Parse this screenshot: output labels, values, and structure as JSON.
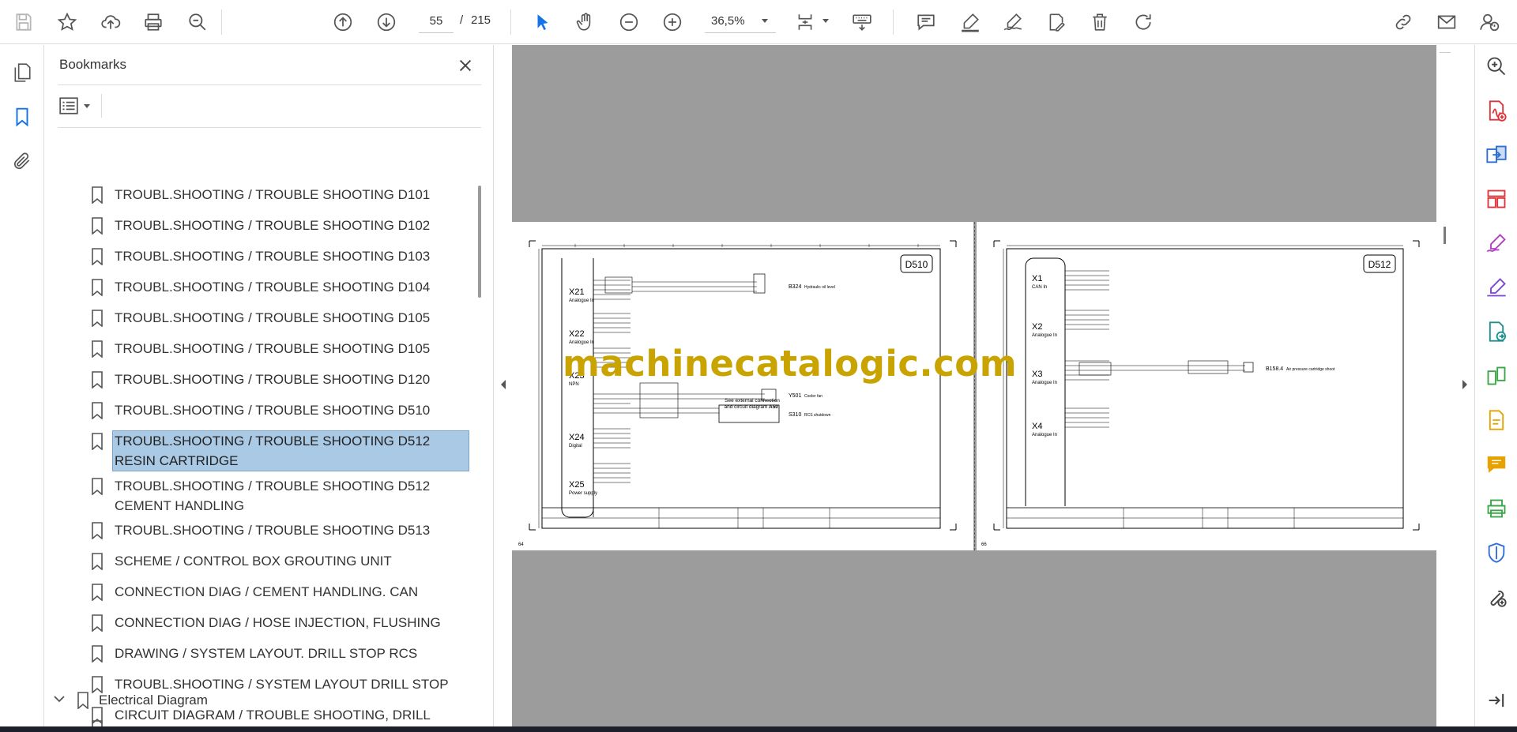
{
  "toolbar": {
    "tools": [
      {
        "name": "save-icon"
      },
      {
        "name": "star-icon"
      },
      {
        "name": "upload-cloud-icon"
      },
      {
        "name": "print-icon"
      },
      {
        "name": "search-zoom-icon"
      },
      {
        "name": "page-up-icon"
      },
      {
        "name": "page-down-icon"
      },
      {
        "name": "select-cursor-icon"
      },
      {
        "name": "hand-icon"
      },
      {
        "name": "zoom-out-icon"
      },
      {
        "name": "zoom-in-icon"
      },
      {
        "name": "page-fit-icon"
      },
      {
        "name": "keyboard-icon"
      },
      {
        "name": "comment-icon"
      },
      {
        "name": "highlight-icon"
      },
      {
        "name": "sign-icon"
      },
      {
        "name": "edit-pdf-icon"
      },
      {
        "name": "delete-icon"
      },
      {
        "name": "rotate-icon"
      },
      {
        "name": "link-icon"
      },
      {
        "name": "email-icon"
      },
      {
        "name": "account-icon"
      }
    ],
    "page_number": "55",
    "page_separator": "/",
    "page_total": "215",
    "zoom": "36,5%"
  },
  "bookmarks": {
    "title": "Bookmarks",
    "items": [
      {
        "label": "TROUBL.SHOOTING / TROUBLE SHOOTING D101"
      },
      {
        "label": "TROUBL.SHOOTING / TROUBLE SHOOTING D102"
      },
      {
        "label": "TROUBL.SHOOTING / TROUBLE SHOOTING D103"
      },
      {
        "label": "TROUBL.SHOOTING / TROUBLE SHOOTING D104"
      },
      {
        "label": "TROUBL.SHOOTING / TROUBLE SHOOTING D105"
      },
      {
        "label": "TROUBL.SHOOTING / TROUBLE SHOOTING D105"
      },
      {
        "label": "TROUBL.SHOOTING / TROUBLE SHOOTING D120"
      },
      {
        "label": "TROUBL.SHOOTING / TROUBLE SHOOTING D510"
      },
      {
        "label": "TROUBL.SHOOTING / TROUBLE SHOOTING D512 RESIN CARTRIDGE",
        "selected": true
      },
      {
        "label": "TROUBL.SHOOTING / TROUBLE SHOOTING D512 CEMENT HANDLING"
      },
      {
        "label": "TROUBL.SHOOTING / TROUBLE SHOOTING D513"
      },
      {
        "label": "SCHEME / CONTROL BOX GROUTING UNIT"
      },
      {
        "label": "CONNECTION DIAG / CEMENT HANDLING. CAN"
      },
      {
        "label": "CONNECTION DIAG / HOSE INJECTION, FLUSHING"
      },
      {
        "label": "DRAWING / SYSTEM LAYOUT. DRILL STOP RCS"
      },
      {
        "label": "TROUBL.SHOOTING / SYSTEM LAYOUT DRILL STOP"
      },
      {
        "label": "CIRCUIT DIAGRAM / TROUBLE SHOOTING, DRILL STOP"
      }
    ],
    "parent_item": {
      "label": "Electrical Diagram"
    }
  },
  "document": {
    "watermark": "machinecatalogic.com",
    "left_page": {
      "diagram_id": "D510",
      "page_no": "64",
      "connectors": [
        {
          "id": "X21",
          "desc": "Analogue In"
        },
        {
          "id": "X22",
          "desc": "Analogue In"
        },
        {
          "id": "X23",
          "desc": "NPN"
        },
        {
          "id": "X24",
          "desc": "Digital"
        },
        {
          "id": "X25",
          "desc": "Power supply"
        }
      ],
      "components": [
        {
          "id": "B324",
          "desc": "Hydraulic oil level"
        },
        {
          "id": "Y501",
          "desc": "Cooler fan"
        },
        {
          "id": "S310",
          "desc": "RCS shutdown"
        }
      ],
      "note_line1": "See external connection",
      "note_line2": "and circuit diagram",
      "note_ref": "A50"
    },
    "right_page": {
      "diagram_id": "D512",
      "page_no": "66",
      "connectors": [
        {
          "id": "X1",
          "desc": "CAN In"
        },
        {
          "id": "X2",
          "desc": "Analogue In"
        },
        {
          "id": "X3",
          "desc": "Analogue In"
        },
        {
          "id": "X4",
          "desc": "Analogue In"
        }
      ],
      "components": [
        {
          "id": "B158.4",
          "desc": "Air pressure cartridge shoot"
        }
      ]
    }
  },
  "right_rail": {
    "tools": [
      {
        "name": "zoom-search-icon",
        "color": "#444444"
      },
      {
        "name": "create-pdf-icon",
        "color": "#e0343b"
      },
      {
        "name": "combine-files-icon",
        "color": "#2d6fd6"
      },
      {
        "name": "organize-pages-icon",
        "color": "#e0343b"
      },
      {
        "name": "fill-sign-icon",
        "color": "#b53cc6"
      },
      {
        "name": "request-signature-icon",
        "color": "#7b44d4"
      },
      {
        "name": "export-pdf-icon",
        "color": "#1d8f8f"
      },
      {
        "name": "compare-files-icon",
        "color": "#3aa648"
      },
      {
        "name": "edit-file-icon",
        "color": "#e8a200"
      },
      {
        "name": "comment-tool-icon",
        "color": "#e8a200"
      },
      {
        "name": "print-production-icon",
        "color": "#3aa648"
      },
      {
        "name": "protect-icon",
        "color": "#2d6fd6"
      },
      {
        "name": "more-tools-icon",
        "color": "#444444"
      },
      {
        "name": "expand-panel-icon",
        "color": "#444444"
      }
    ]
  }
}
